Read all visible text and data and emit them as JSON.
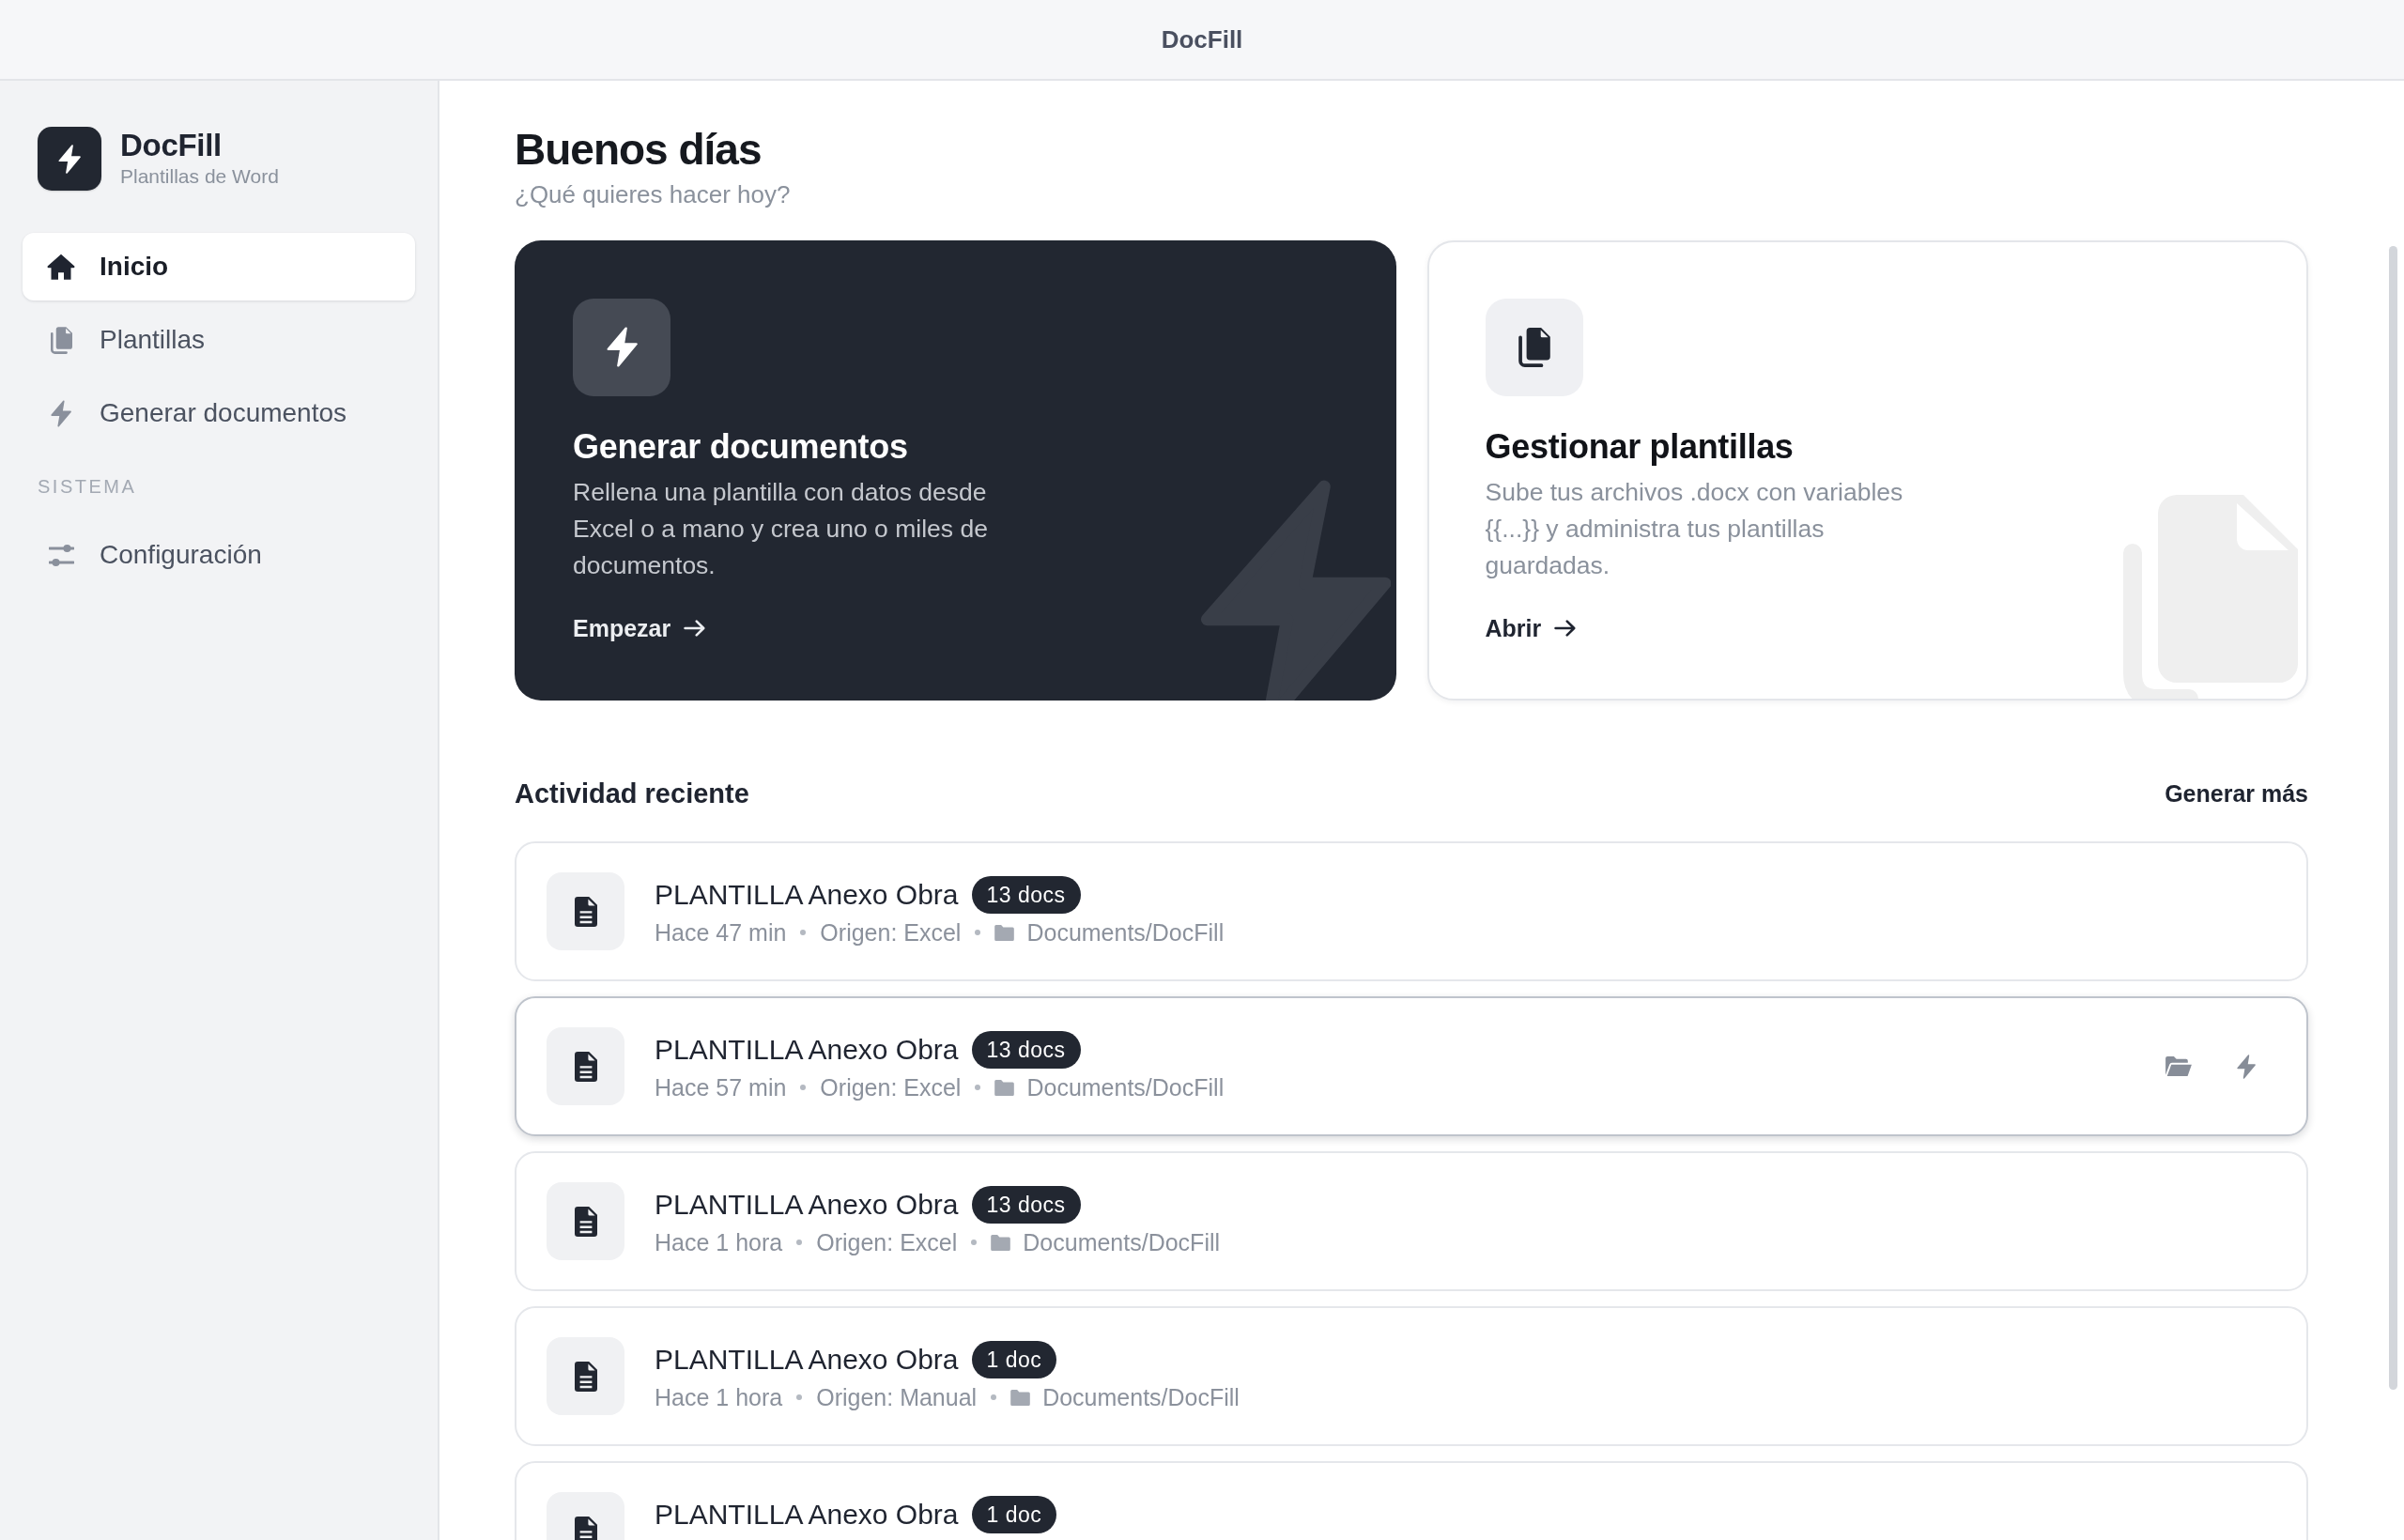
{
  "window": {
    "title": "DocFill"
  },
  "sidebar": {
    "app_name": "DocFill",
    "app_subtitle": "Plantillas de Word",
    "groups": [
      {
        "items": [
          {
            "kind": "home",
            "label": "Inicio",
            "selected": true
          },
          {
            "kind": "templates",
            "label": "Plantillas",
            "selected": false
          },
          {
            "kind": "generate",
            "label": "Generar documentos",
            "selected": false
          }
        ]
      },
      {
        "heading": "SISTEMA",
        "items": [
          {
            "kind": "settings",
            "label": "Configuración",
            "selected": false
          }
        ]
      }
    ]
  },
  "greeting": {
    "title": "Buenos días",
    "subtitle": "¿Qué quieres hacer hoy?"
  },
  "action_cards": [
    {
      "kind": "generate",
      "title": "Generar documentos",
      "description": "Rellena una plantilla con datos desde Excel o a mano y crea uno o miles de documentos.",
      "link": "Empezar"
    },
    {
      "kind": "templates",
      "title": "Gestionar plantillas",
      "description": "Sube tus archivos .docx con variables {{...}} y administra tus plantillas guardadas.",
      "link": "Abrir"
    }
  ],
  "recent_activity": {
    "title": "Actividad reciente",
    "action": "Generar más",
    "rows": [
      {
        "title": "PLANTILLA Anexo Obra",
        "badge": "13 docs",
        "time": "Hace 47 min",
        "origin": "Origen: Excel",
        "path": "Documents/DocFill",
        "hovered": false
      },
      {
        "title": "PLANTILLA Anexo Obra",
        "badge": "13 docs",
        "time": "Hace 57 min",
        "origin": "Origen: Excel",
        "path": "Documents/DocFill",
        "hovered": true
      },
      {
        "title": "PLANTILLA Anexo Obra",
        "badge": "13 docs",
        "time": "Hace 1 hora",
        "origin": "Origen: Excel",
        "path": "Documents/DocFill",
        "hovered": false
      },
      {
        "title": "PLANTILLA Anexo Obra",
        "badge": "1 doc",
        "time": "Hace 1 hora",
        "origin": "Origen: Manual",
        "path": "Documents/DocFill",
        "hovered": false
      },
      {
        "title": "PLANTILLA Anexo Obra",
        "badge": "1 doc",
        "hovered": false
      }
    ]
  }
}
